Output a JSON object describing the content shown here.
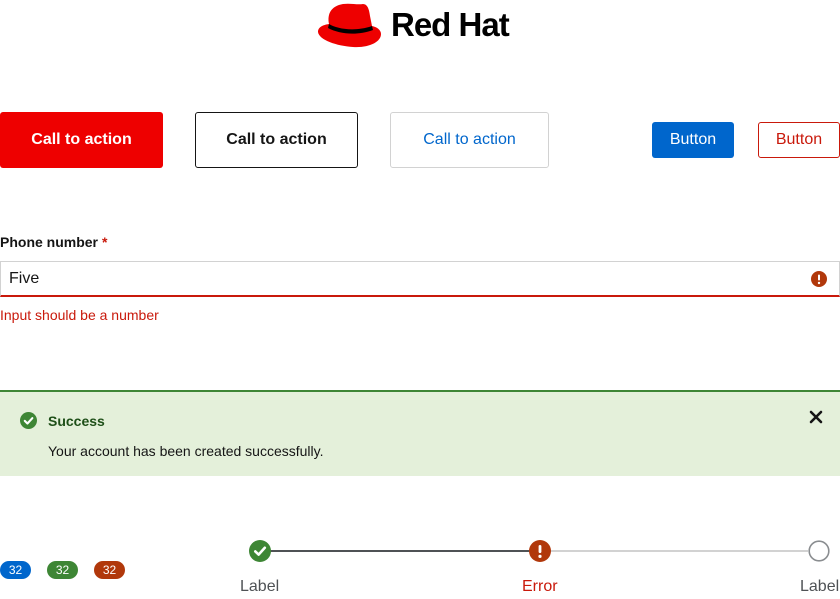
{
  "brand": {
    "name": "Red Hat",
    "logo_icon": "red-hat-fedora-icon",
    "colors": {
      "brand_red": "#ee0000",
      "black": "#000000"
    }
  },
  "buttons": {
    "cta_primary": "Call to action",
    "cta_secondary": "Call to action",
    "cta_tertiary": "Call to action",
    "button_primary": "Button",
    "button_danger": "Button",
    "colors": {
      "cta_primary_bg": "#ee0000",
      "primary_bg": "#0066cc",
      "danger": "#c9190b",
      "link": "#0066cc"
    }
  },
  "form": {
    "label": "Phone number",
    "required_marker": "*",
    "value": "Five",
    "error_icon": "exclamation-circle-icon",
    "helper_text": "Input should be a number",
    "colors": {
      "error": "#c9190b"
    }
  },
  "alert": {
    "icon": "check-circle-icon",
    "title": "Success",
    "body": "Your account has been created successfully.",
    "close_icon": "close-icon",
    "colors": {
      "background": "#e4f0da",
      "border": "#3e8635",
      "title": "#1e4f18"
    }
  },
  "badges": [
    {
      "value": "32",
      "color": "#0066cc"
    },
    {
      "value": "32",
      "color": "#3e8635"
    },
    {
      "value": "32",
      "color": "#b1380b"
    }
  ],
  "stepper": {
    "steps": [
      {
        "label": "Label",
        "status": "success",
        "icon": "check-circle-icon"
      },
      {
        "label": "Error",
        "status": "error",
        "icon": "exclamation-circle-icon"
      },
      {
        "label": "Label",
        "status": "pending",
        "icon": "empty-circle-icon"
      }
    ]
  }
}
